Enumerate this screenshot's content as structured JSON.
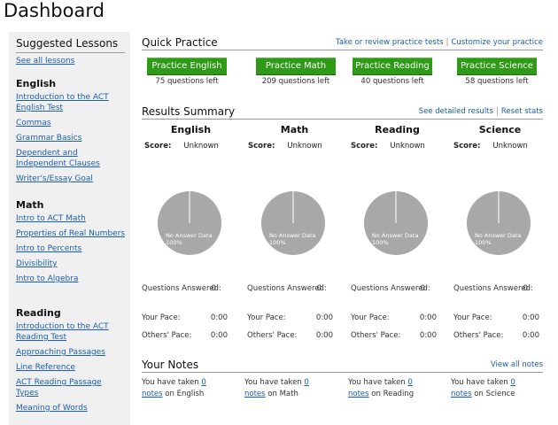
{
  "page_title": "Dashboard",
  "sidebar": {
    "heading": "Suggested Lessons",
    "see_all": "See all lessons",
    "sections": [
      {
        "title": "English",
        "lessons": [
          "Introduction to the ACT English Test",
          "Commas",
          "Grammar Basics",
          "Dependent and Independent Clauses",
          "Writer's/Essay Goal"
        ]
      },
      {
        "title": "Math",
        "lessons": [
          "Intro to ACT Math",
          "Properties of Real Numbers",
          "Intro to Percents",
          "Divisibility",
          "Intro to Algebra"
        ]
      },
      {
        "title": "Reading",
        "lessons": [
          "Introduction to the ACT Reading Test",
          "Approaching Passages",
          "Line Reference",
          "ACT Reading Passage Types",
          "Meaning of Words"
        ]
      }
    ]
  },
  "quick_practice": {
    "heading": "Quick Practice",
    "link_tests": "Take or review practice tests",
    "separator": "|",
    "link_customize": "Customize your practice",
    "buttons": [
      {
        "label": "Practice English",
        "left": "75 questions left"
      },
      {
        "label": "Practice Math",
        "left": "209 questions left"
      },
      {
        "label": "Practice Reading",
        "left": "40 questions left"
      },
      {
        "label": "Practice Science",
        "left": "58 questions left"
      }
    ]
  },
  "results": {
    "heading": "Results Summary",
    "link_detailed": "See detailed results",
    "separator": "|",
    "link_reset": "Reset stats",
    "score_label": "Score:",
    "questions_label": "Questions Answered:",
    "pace_label": "Your Pace:",
    "others_label": "Others' Pace:",
    "pie_label": "No Answer Data",
    "pie_percent": "100%",
    "pie_color": "#a8a8a8",
    "subjects": [
      {
        "name": "English",
        "score": "Unknown",
        "answered": "0",
        "pace": "0:00",
        "others": "0:00"
      },
      {
        "name": "Math",
        "score": "Unknown",
        "answered": "0",
        "pace": "0:00",
        "others": "0:00"
      },
      {
        "name": "Reading",
        "score": "Unknown",
        "answered": "0",
        "pace": "0:00",
        "others": "0:00"
      },
      {
        "name": "Science",
        "score": "Unknown",
        "answered": "0",
        "pace": "0:00",
        "others": "0:00"
      }
    ]
  },
  "notes": {
    "heading": "Your Notes",
    "view_all": "View all notes",
    "prefix": "You have taken",
    "count": "0",
    "notes_word": "notes",
    "items": [
      {
        "subject": "on English"
      },
      {
        "subject": "on Math"
      },
      {
        "subject": "on Reading"
      },
      {
        "subject": "on Science"
      }
    ]
  },
  "colors": {
    "accent_green": "#2e9a17",
    "link": "#1a5fb4",
    "sidebar_bg": "#f0f0f0"
  }
}
